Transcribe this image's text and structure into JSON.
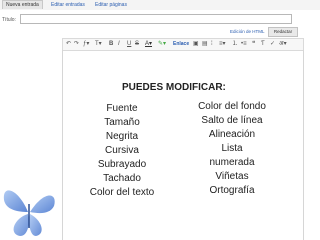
{
  "tabs": {
    "new_post": "Nueva entrada",
    "edit_posts": "Editar entradas",
    "edit_pages": "Editar páginas"
  },
  "title_label": "Título:",
  "mode": {
    "html_link": "Edición de HTML",
    "compose": "Redactar"
  },
  "toolbar": {
    "link_label": "Enlace"
  },
  "content": {
    "heading": "PUEDES MODIFICAR:",
    "left": [
      "Fuente",
      "Tamaño",
      "Negrita",
      "Cursiva",
      "Subrayado",
      "Tachado",
      "Color del texto"
    ],
    "right": [
      "Color del fondo",
      "Salto de línea",
      "Alineación",
      "Lista",
      "numerada",
      "Viñetas",
      "Ortografía"
    ]
  },
  "colors": {
    "accent": "#2a5db0",
    "butterfly_blue": "#5b8bd9"
  }
}
